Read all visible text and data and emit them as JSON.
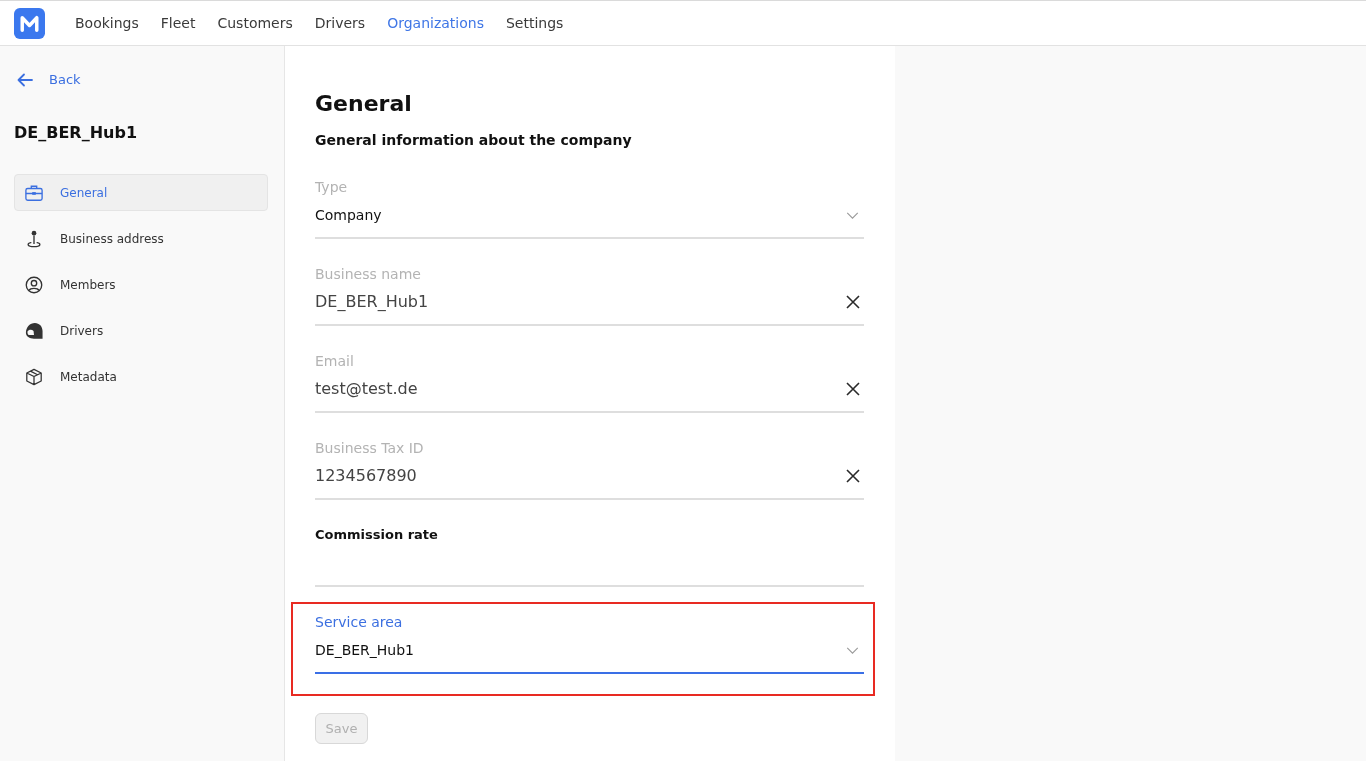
{
  "top_nav": {
    "items": [
      {
        "label": "Bookings",
        "selected": false
      },
      {
        "label": "Fleet",
        "selected": false
      },
      {
        "label": "Customers",
        "selected": false
      },
      {
        "label": "Drivers",
        "selected": false
      },
      {
        "label": "Organizations",
        "selected": true
      },
      {
        "label": "Settings",
        "selected": false
      }
    ]
  },
  "sidebar": {
    "back_link": "Back",
    "title": "DE_BER_Hub1",
    "items": [
      {
        "label": "General",
        "selected": true
      },
      {
        "label": "Business address",
        "selected": false
      },
      {
        "label": "Members",
        "selected": false
      },
      {
        "label": "Drivers",
        "selected": false
      },
      {
        "label": "Metadata",
        "selected": false
      }
    ]
  },
  "page": {
    "title": "General",
    "subtitle": "General information about the company"
  },
  "fields": [
    {
      "kind": "select",
      "label": "Type",
      "value": "Company",
      "focused": false,
      "highlighted": false
    },
    {
      "kind": "text",
      "label": "Business name",
      "value": "DE_BER_Hub1",
      "focused": false,
      "highlighted": false
    },
    {
      "kind": "text",
      "label": "Email",
      "value": "test@test.de",
      "focused": false,
      "highlighted": false
    },
    {
      "kind": "text",
      "label": "Business Tax ID",
      "value": "1234567890",
      "focused": false,
      "highlighted": false
    },
    {
      "kind": "text",
      "label": "Commission rate",
      "focused": false,
      "highlighted": false
    },
    {
      "kind": "select",
      "label": "Service area",
      "value": "DE_BER_Hub1",
      "focused": true,
      "highlighted": true
    }
  ],
  "save_button": {
    "label": "Save",
    "disabled": true
  }
}
